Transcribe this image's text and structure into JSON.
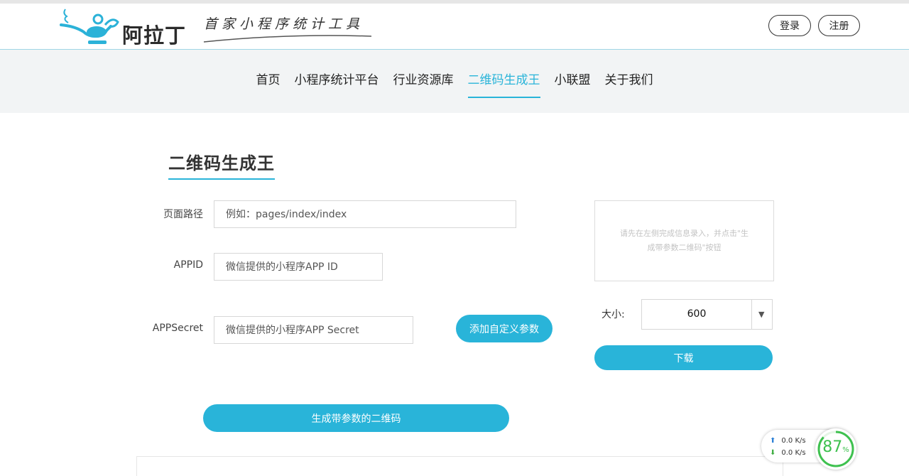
{
  "header": {
    "logo_text": "阿拉丁",
    "slogan": "首家小程序统计工具",
    "login_label": "登录",
    "register_label": "注册",
    "brand_color": "#29b4d9"
  },
  "nav": {
    "items": [
      {
        "label": "首页",
        "active": false
      },
      {
        "label": "小程序统计平台",
        "active": false
      },
      {
        "label": "行业资源库",
        "active": false
      },
      {
        "label": "二维码生成王",
        "active": true
      },
      {
        "label": "小联盟",
        "active": false
      },
      {
        "label": "关于我们",
        "active": false
      }
    ]
  },
  "main": {
    "title": "二维码生成王",
    "fields": {
      "path": {
        "label": "页面路径",
        "placeholder": "例如：pages/index/index",
        "value": ""
      },
      "appid": {
        "label": "APPID",
        "placeholder": "微信提供的小程序APP ID",
        "value": ""
      },
      "secret": {
        "label": "APPSecret",
        "placeholder": "微信提供的小程序APP Secret",
        "value": ""
      }
    },
    "add_param_label": "添加自定义参数",
    "generate_label": "生成带参数的二维码",
    "preview_hint": "请先在左侧完成信息录入，并点击\"生成带参数二维码\"按钮",
    "size_label": "大小:",
    "size_value": "600",
    "download_label": "下载"
  },
  "speed_widget": {
    "upload": "0.0 K/s",
    "download": "0.0 K/s",
    "percent": 87,
    "percent_label": "87",
    "percent_sign": "%"
  }
}
